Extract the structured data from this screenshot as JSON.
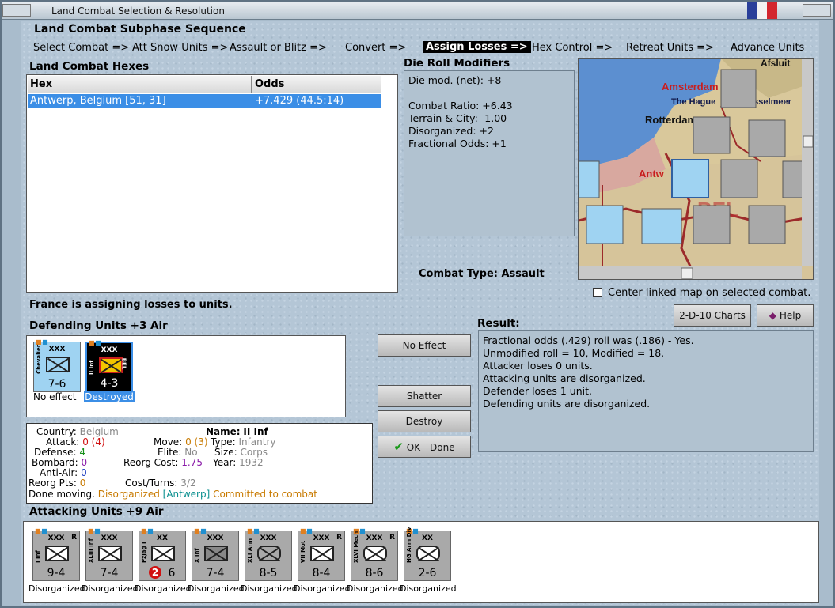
{
  "window": {
    "title": "Land Combat Selection & Resolution"
  },
  "sequence": {
    "title": "Land Combat Subphase Sequence",
    "steps": [
      "Select Combat =>",
      "Att Snow Units =>",
      "Assault or Blitz =>",
      "Convert =>",
      "Assign Losses =>",
      "Hex Control =>",
      "Retreat Units =>",
      "Advance Units"
    ],
    "active": "Assign Losses =>"
  },
  "hexes": {
    "title": "Land Combat Hexes",
    "columns": [
      "Hex",
      "Odds"
    ],
    "rows": [
      {
        "hex": "Antwerp, Belgium [51, 31]",
        "odds": "+7.429 (44.5:14)"
      }
    ]
  },
  "modifiers": {
    "title": "Die Roll Modifiers",
    "lines": [
      "Die mod. (net): +8",
      "",
      "Combat Ratio: +6.43",
      "Terrain & City: -1.00",
      "Disorganized: +2",
      "Fractional Odds: +1"
    ]
  },
  "combat_type": {
    "label": "Combat Type:",
    "value": "Assault"
  },
  "map": {
    "labels": [
      "Afsluit",
      "Amsterdam",
      "The Hague",
      "IJsselmeer",
      "Rotterdam",
      "Antw",
      "BEL"
    ],
    "center_label": "Center linked map on selected combat."
  },
  "status": "France is assigning losses to units.",
  "defending": {
    "title": "Defending Units +3 Air",
    "units": [
      {
        "size": "XXX",
        "name": "Chevalier",
        "strength": "7-6",
        "caption": "No effect",
        "flag": ""
      },
      {
        "size": "XXX",
        "name": "II Inf",
        "strength": "4-3",
        "caption": "Destroyed",
        "flag": "BEL"
      }
    ]
  },
  "buttons": {
    "no_effect": "No Effect",
    "shatter": "Shatter",
    "destroy": "Destroy",
    "ok": "OK - Done",
    "charts": "2-D-10 Charts",
    "help": "Help"
  },
  "details": {
    "country_label": "Country:",
    "country": "Belgium",
    "attack_label": "Attack:",
    "attack": "0",
    "attack_base": "(4)",
    "defense_label": "Defense:",
    "defense": "4",
    "bombard_label": "Bombard:",
    "bombard": "0",
    "antiair_label": "Anti-Air:",
    "antiair": "0",
    "reorg_label": "Reorg Pts:",
    "reorg": "0",
    "name_label": "Name:",
    "name": "II Inf",
    "move_label": "Move:",
    "move": "0",
    "move_base": "(3)",
    "type_label": "Type:",
    "type": "Infantry",
    "elite_label": "Elite:",
    "elite": "No",
    "size_label": "Size:",
    "size": "Corps",
    "reorg_cost_label": "Reorg Cost:",
    "reorg_cost": "1.75",
    "year_label": "Year:",
    "year": "1932",
    "cost_label": "Cost/Turns:",
    "cost": "3/2",
    "done": "Done moving.",
    "disorg": "Disorganized",
    "loc": "[Antwerp]",
    "committed": "Committed to combat"
  },
  "result": {
    "title": "Result:",
    "lines": [
      "Fractional odds (.429) roll was (.186)  - Yes.",
      "Unmodified roll = 10, Modified = 18.",
      "Attacker loses 0 units.",
      "Attacking units are disorganized.",
      "Defender loses 1 unit.",
      "Defending units are disorganized."
    ]
  },
  "attacking": {
    "title": "Attacking Units +9 Air",
    "units": [
      {
        "size": "XXX",
        "name": "I Inf",
        "strength": "9-4",
        "caption": "Disorganized",
        "r": "R"
      },
      {
        "size": "XXX",
        "name": "XLIII Inf",
        "strength": "7-4",
        "caption": "Disorganized",
        "r": ""
      },
      {
        "size": "XX",
        "name": "PzJag I",
        "strength": "6",
        "caption": "Disorganized",
        "r": "",
        "badge": "2"
      },
      {
        "size": "XXX",
        "name": "X Inf",
        "strength": "7-4",
        "caption": "Disorganized",
        "r": ""
      },
      {
        "size": "XXX",
        "name": "XLI Arm",
        "strength": "8-5",
        "caption": "Disorganized",
        "r": ""
      },
      {
        "size": "XXX",
        "name": "VII Mot",
        "strength": "8-4",
        "caption": "Disorganized",
        "r": "R"
      },
      {
        "size": "XXX",
        "name": "XLVI Mech",
        "strength": "8-6",
        "caption": "Disorganized",
        "r": "R"
      },
      {
        "size": "XX",
        "name": "HG Arm Div",
        "strength": "2-6",
        "caption": "Disorganized",
        "r": ""
      }
    ]
  },
  "colors": {
    "active_bg": "#000000",
    "selection": "#3b8ee6",
    "destroyed_bg": "#000000",
    "attack_red": "#d01010",
    "defense_green": "#18901c",
    "orange": "#c87a00",
    "purple": "#8a1aa8",
    "cyan": "#0a8f8f"
  }
}
